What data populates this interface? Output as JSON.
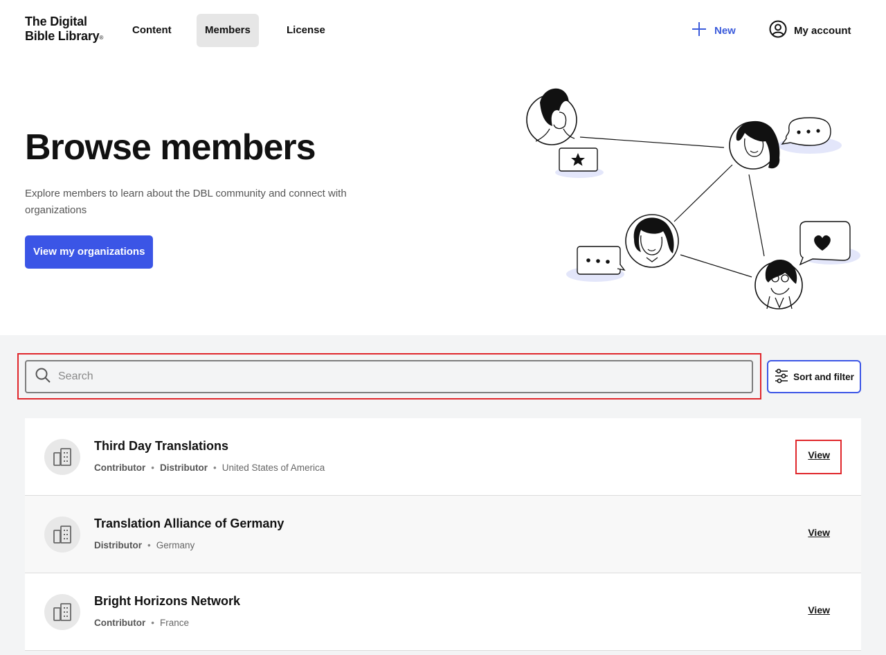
{
  "header": {
    "logo_line1": "The Digital",
    "logo_line2": "Bible Library",
    "logo_mark": "®",
    "nav": [
      {
        "label": "Content",
        "active": false
      },
      {
        "label": "Members",
        "active": true
      },
      {
        "label": "License",
        "active": false
      }
    ],
    "new_label": "New",
    "account_label": "My account"
  },
  "hero": {
    "title": "Browse members",
    "description": "Explore members to learn about the DBL community and connect with organizations",
    "button_label": "View my organizations"
  },
  "search": {
    "placeholder": "Search",
    "value": "",
    "sort_label": "Sort and filter"
  },
  "members": [
    {
      "name": "Third Day Translations",
      "roles": [
        "Contributor",
        "Distributor"
      ],
      "country": "United States of America",
      "action": "View"
    },
    {
      "name": "Translation Alliance of Germany",
      "roles": [
        "Distributor"
      ],
      "country": "Germany",
      "action": "View"
    },
    {
      "name": "Bright Horizons Network",
      "roles": [
        "Contributor"
      ],
      "country": "France",
      "action": "View"
    }
  ],
  "colors": {
    "accent": "#3b55e6",
    "highlight": "#e0262b",
    "section_bg": "#f3f4f5"
  },
  "icons": {
    "new": "plus-icon",
    "account": "user-circle-icon",
    "search": "search-icon",
    "sort": "sliders-icon",
    "member": "building-icon"
  }
}
